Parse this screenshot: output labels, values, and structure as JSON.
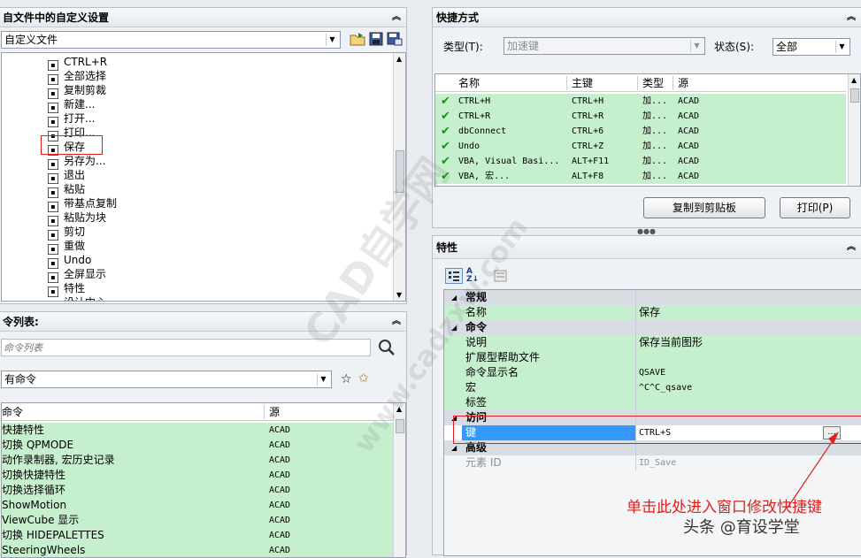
{
  "left_top": {
    "title": "自文件中的自定义设置",
    "file_combo": "自定义文件",
    "tree_items": [
      "CTRL+R",
      "全部选择",
      "复制剪裁",
      "新建...",
      "打开...",
      "打印...",
      "保存",
      "另存为...",
      "退出",
      "粘贴",
      "带基点复制",
      "粘贴为块",
      "剪切",
      "重做",
      "Undo",
      "全屏显示",
      "特性",
      "设计中心"
    ]
  },
  "left_bottom": {
    "title": "令列表:",
    "search_placeholder": "命令列表",
    "filter_combo": "有命令",
    "col_command": "命令",
    "col_source": "源",
    "rows": [
      {
        "name": "快捷特性",
        "src": "ACAD"
      },
      {
        "name": "切换 QPMODE",
        "src": "ACAD"
      },
      {
        "name": "动作录制器, 宏历史记录",
        "src": "ACAD"
      },
      {
        "name": "切换快捷特性",
        "src": "ACAD"
      },
      {
        "name": "切换选择循环",
        "src": "ACAD"
      },
      {
        "name": "ShowMotion",
        "src": "ACAD"
      },
      {
        "name": "ViewCube 显示",
        "src": "ACAD"
      },
      {
        "name": "切换 HIDEPALETTES",
        "src": "ACAD"
      },
      {
        "name": "SteeringWheels",
        "src": "ACAD"
      }
    ]
  },
  "shortcuts": {
    "title": "快捷方式",
    "type_label": "类型(T):",
    "type_value": "加速键",
    "state_label": "状态(S):",
    "state_value": "全部",
    "cols": [
      "名称",
      "主键",
      "类型",
      "源"
    ],
    "rows": [
      {
        "name": "CTRL+H",
        "key": "CTRL+H",
        "type": "加...",
        "src": "ACAD"
      },
      {
        "name": "CTRL+R",
        "key": "CTRL+R",
        "type": "加...",
        "src": "ACAD"
      },
      {
        "name": "dbConnect",
        "key": "CTRL+6",
        "type": "加...",
        "src": "ACAD"
      },
      {
        "name": "Undo",
        "key": "CTRL+Z",
        "type": "加...",
        "src": "ACAD"
      },
      {
        "name": "VBA, Visual Basi...",
        "key": "ALT+F11",
        "type": "加...",
        "src": "ACAD"
      },
      {
        "name": "VBA, 宏...",
        "key": "ALT+F8",
        "type": "加...",
        "src": "ACAD"
      }
    ],
    "copy_button": "复制到剪贴板",
    "print_button": "打印(P)"
  },
  "properties": {
    "title": "特性",
    "cat_general": "常规",
    "name_label": "名称",
    "name_value": "保存",
    "cat_command": "命令",
    "desc_label": "说明",
    "desc_value": "保存当前图形",
    "ext_label": "扩展型帮助文件",
    "ext_value": "",
    "cmd_label": "命令显示名",
    "cmd_value": "QSAVE",
    "macro_label": "宏",
    "macro_value": "^C^C_qsave",
    "tags_label": "标签",
    "cat_access": "访问",
    "key_label": "键",
    "key_value": "CTRL+S",
    "ellipsis": "...",
    "cat_advanced": "高级",
    "elemid_label": "元素 ID",
    "elemid_value": "ID_Save"
  },
  "annotation": {
    "text": "单击此处进入窗口修改快捷键",
    "color": "#e0201a"
  },
  "watermark": {
    "text1": "CAD自学网",
    "text2": "www.cadzxw.com",
    "byline": "头条 @育设学堂"
  }
}
